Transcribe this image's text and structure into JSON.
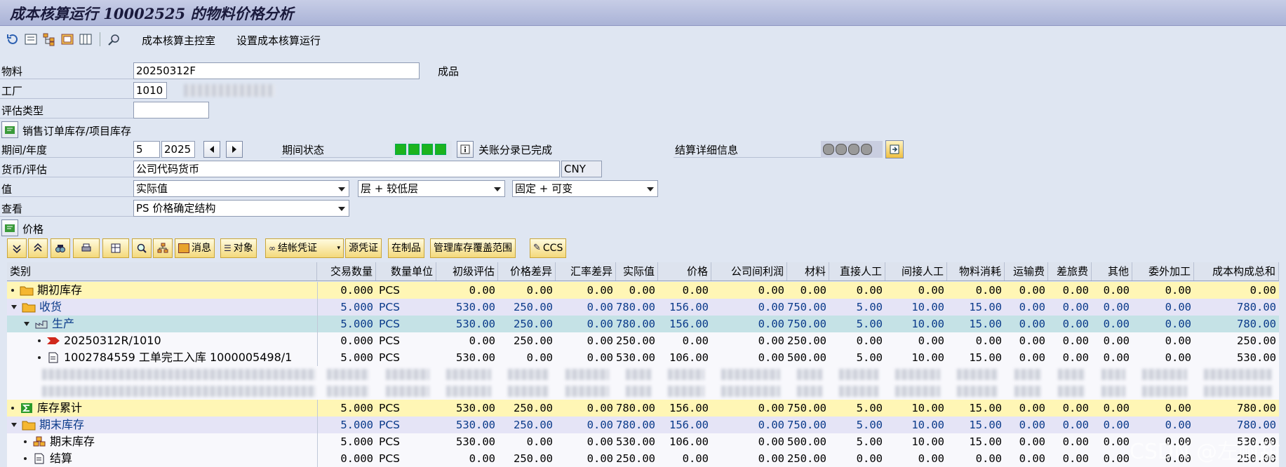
{
  "window": {
    "title": "成本核算运行 10002525 的物料价格分析"
  },
  "toolbar": {
    "link1": "成本核算主控室",
    "link2": "设置成本核算运行"
  },
  "form": {
    "material_label": "物料",
    "material_value": "20250312F",
    "material_type": "成品",
    "plant_label": "工厂",
    "plant_value": "1010",
    "valtype_label": "评估类型",
    "valtype_value": "",
    "sales_stock_label": "销售订单库存/项目库存",
    "period_label": "期间/年度",
    "period_value": "5",
    "year_value": "2025",
    "period_status_label": "期间状态",
    "posting_done": "关账分录已完成",
    "settlement_label": "结算详细信息",
    "currency_label": "货币/评估",
    "currency_value": "公司代码货币",
    "currency_code": "CNY",
    "value_label": "值",
    "value_select": "实际值",
    "level_select": "层 + 较低层",
    "fixvar_select": "固定 + 可变",
    "view_label": "查看",
    "view_select": "PS 价格确定结构",
    "price_section": "价格"
  },
  "grid_toolbar": {
    "msg": "消息",
    "obj": "对象",
    "closing_doc": "结帐凭证",
    "src_doc": "源凭证",
    "wip": "在制品",
    "stock_coverage": "管理库存覆盖范围",
    "ccs": "CCS"
  },
  "columns": [
    "类别",
    "交易数量",
    "数量单位",
    "初级评估",
    "价格差异",
    "汇率差异",
    "实际值",
    "价格",
    "公司间利润",
    "材料",
    "直接人工",
    "间接人工",
    "物料消耗",
    "运输费",
    "差旅费",
    "其他",
    "委外加工",
    "成本构成总和"
  ],
  "rows": [
    {
      "label": "期初库存",
      "vals": [
        "0.000",
        "PCS",
        "0.00",
        "0.00",
        "0.00",
        "0.00",
        "0.00",
        "0.00",
        "0.00",
        "0.00",
        "0.00",
        "0.00",
        "0.00",
        "0.00",
        "0.00",
        "0.00",
        "0.00"
      ]
    },
    {
      "label": "收货",
      "vals": [
        "5.000",
        "PCS",
        "530.00",
        "250.00",
        "0.00",
        "780.00",
        "156.00",
        "0.00",
        "750.00",
        "5.00",
        "10.00",
        "15.00",
        "0.00",
        "0.00",
        "0.00",
        "0.00",
        "780.00"
      ]
    },
    {
      "label": "生产",
      "vals": [
        "5.000",
        "PCS",
        "530.00",
        "250.00",
        "0.00",
        "780.00",
        "156.00",
        "0.00",
        "750.00",
        "5.00",
        "10.00",
        "15.00",
        "0.00",
        "0.00",
        "0.00",
        "0.00",
        "780.00"
      ]
    },
    {
      "label": "20250312R/1010",
      "vals": [
        "0.000",
        "PCS",
        "0.00",
        "250.00",
        "0.00",
        "250.00",
        "0.00",
        "0.00",
        "250.00",
        "0.00",
        "0.00",
        "0.00",
        "0.00",
        "0.00",
        "0.00",
        "0.00",
        "250.00"
      ]
    },
    {
      "label": "1002784559 工单完工入库 1000005498/1",
      "vals": [
        "5.000",
        "PCS",
        "530.00",
        "0.00",
        "0.00",
        "530.00",
        "106.00",
        "0.00",
        "500.00",
        "5.00",
        "10.00",
        "15.00",
        "0.00",
        "0.00",
        "0.00",
        "0.00",
        "530.00"
      ]
    },
    {
      "label": "库存累计",
      "vals": [
        "5.000",
        "PCS",
        "530.00",
        "250.00",
        "0.00",
        "780.00",
        "156.00",
        "0.00",
        "750.00",
        "5.00",
        "10.00",
        "15.00",
        "0.00",
        "0.00",
        "0.00",
        "0.00",
        "780.00"
      ]
    },
    {
      "label": "期末库存",
      "vals": [
        "5.000",
        "PCS",
        "530.00",
        "250.00",
        "0.00",
        "780.00",
        "156.00",
        "0.00",
        "750.00",
        "5.00",
        "10.00",
        "15.00",
        "0.00",
        "0.00",
        "0.00",
        "0.00",
        "780.00"
      ]
    },
    {
      "label": "期末库存",
      "vals": [
        "5.000",
        "PCS",
        "530.00",
        "0.00",
        "0.00",
        "530.00",
        "106.00",
        "0.00",
        "500.00",
        "5.00",
        "10.00",
        "15.00",
        "0.00",
        "0.00",
        "0.00",
        "0.00",
        "530.00"
      ]
    },
    {
      "label": "结算",
      "vals": [
        "0.000",
        "PCS",
        "0.00",
        "250.00",
        "0.00",
        "250.00",
        "0.00",
        "0.00",
        "250.00",
        "0.00",
        "0.00",
        "0.00",
        "0.00",
        "0.00",
        "0.00",
        "0.00",
        "250.00"
      ]
    }
  ],
  "watermark": "CSDN @左耐甜",
  "colors": {
    "yellow_row": "#fff6b5",
    "lavender_row": "#e5e4f6",
    "teal_row": "#c5e2e6",
    "blue_text": "#0a3a8a"
  }
}
